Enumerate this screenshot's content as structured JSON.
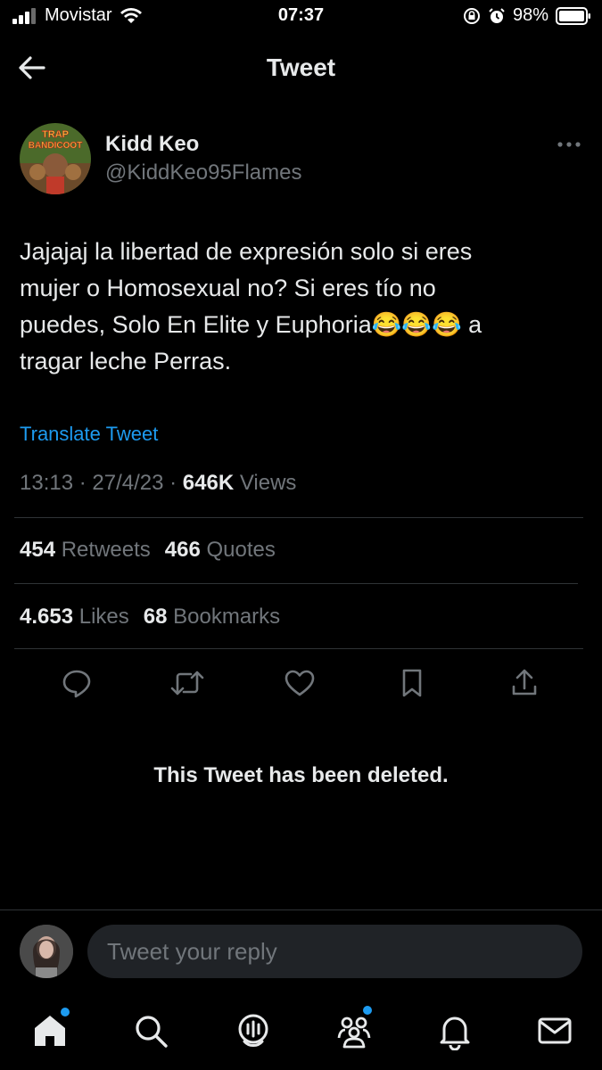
{
  "status_bar": {
    "carrier": "Movistar",
    "time": "07:37",
    "battery": "98%"
  },
  "nav": {
    "title": "Tweet",
    "back_icon": "arrow-left-icon"
  },
  "tweet": {
    "display_name": "Kidd Keo",
    "handle": "@KiddKeo95Flames",
    "avatar_text": [
      "TRAP",
      "BANDICOOT"
    ],
    "text": "Jajajaj la libertad de expresión solo si eres\nmujer o Homosexual no? Si eres tío no\npuedes, Solo En Elite y Euphoria😂😂😂 a\ntragar leche Perras.",
    "translate_label": "Translate Tweet",
    "time": "13:13",
    "date": "27/4/23",
    "views_count": "646K",
    "views_label": "Views",
    "retweets_count": "454",
    "retweets_label": "Retweets",
    "quotes_count": "466",
    "quotes_label": "Quotes",
    "likes_count": "4.653",
    "likes_label": "Likes",
    "bookmarks_count": "68",
    "bookmarks_label": "Bookmarks"
  },
  "deleted_notice": "This Tweet has been deleted.",
  "reply": {
    "placeholder": "Tweet your reply"
  },
  "colors": {
    "background": "#000000",
    "text": "#e7e9ea",
    "muted": "#71767b",
    "accent": "#1d9bf0",
    "divider": "#2f3336"
  }
}
